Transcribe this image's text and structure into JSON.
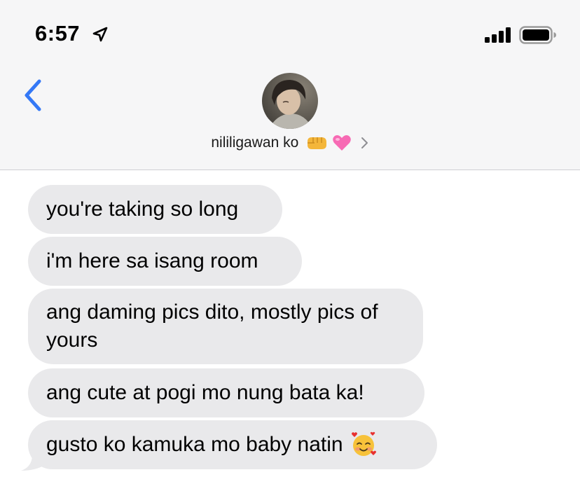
{
  "status_bar": {
    "time": "6:57",
    "icons": [
      "location-arrow-icon",
      "signal-bars-icon",
      "battery-icon"
    ]
  },
  "header": {
    "back_icon": "chevron-left-icon",
    "contact_name": "nililigawan ko",
    "contact_emojis": [
      "fist-bump-emoji",
      "pink-heart-emoji"
    ],
    "chevron_icon": "chevron-right-icon"
  },
  "messages": [
    {
      "text": "you're taking so long"
    },
    {
      "text": "i'm here sa isang room"
    },
    {
      "text": "ang daming pics dito, mostly pics of yours"
    },
    {
      "text": "ang cute at pogi mo nung bata ka!"
    },
    {
      "text": "gusto ko kamuka mo baby natin",
      "emoji": "smiling-face-with-hearts-emoji"
    }
  ],
  "colors": {
    "accent": "#3478f6",
    "bubble": "#e9e9eb",
    "header_bg": "#f6f6f7"
  }
}
